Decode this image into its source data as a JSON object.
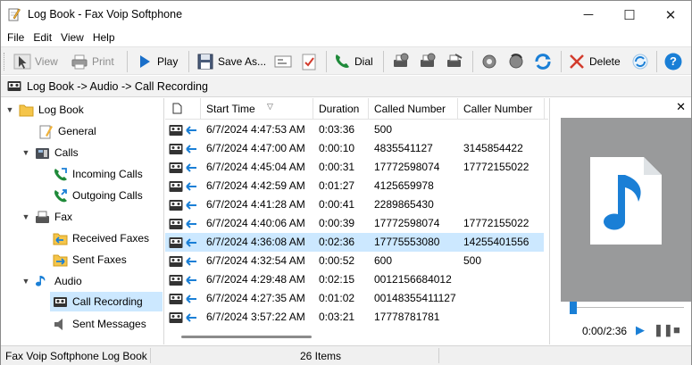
{
  "window": {
    "title": "Log Book - Fax Voip Softphone",
    "controls": {
      "minimize": "─",
      "maximize": "☐",
      "close": "✕"
    }
  },
  "menu": [
    {
      "label": "File"
    },
    {
      "label": "Edit"
    },
    {
      "label": "View"
    },
    {
      "label": "Help"
    }
  ],
  "toolbar": {
    "view_label": "View",
    "print_label": "Print",
    "play_label": "Play",
    "save_as_label": "Save As...",
    "dial_label": "Dial",
    "delete_label": "Delete",
    "help_label": "?"
  },
  "path": {
    "text": "Log Book -> Audio -> Call Recording"
  },
  "tree": {
    "log_book": "Log Book",
    "general": "General",
    "calls": "Calls",
    "incoming_calls": "Incoming Calls",
    "outgoing_calls": "Outgoing Calls",
    "fax": "Fax",
    "received_faxes": "Received Faxes",
    "sent_faxes": "Sent Faxes",
    "audio": "Audio",
    "call_recording": "Call Recording",
    "sent_messages": "Sent Messages"
  },
  "list": {
    "columns": {
      "start_time": "Start Time",
      "duration": "Duration",
      "called_number": "Called Number",
      "caller_number": "Caller Number"
    },
    "rows": [
      {
        "start": "6/7/2024 4:47:53 AM",
        "duration": "0:03:36",
        "called": "500",
        "caller": ""
      },
      {
        "start": "6/7/2024 4:47:00 AM",
        "duration": "0:00:10",
        "called": "4835541127",
        "caller": "3145854422"
      },
      {
        "start": "6/7/2024 4:45:04 AM",
        "duration": "0:00:31",
        "called": "17772598074",
        "caller": "17772155022"
      },
      {
        "start": "6/7/2024 4:42:59 AM",
        "duration": "0:01:27",
        "called": "4125659978",
        "caller": ""
      },
      {
        "start": "6/7/2024 4:41:28 AM",
        "duration": "0:00:41",
        "called": "2289865430",
        "caller": ""
      },
      {
        "start": "6/7/2024 4:40:06 AM",
        "duration": "0:00:39",
        "called": "17772598074",
        "caller": "17772155022"
      },
      {
        "start": "6/7/2024 4:36:08 AM",
        "duration": "0:02:36",
        "called": "17775553080",
        "caller": "14255401556"
      },
      {
        "start": "6/7/2024 4:32:54 AM",
        "duration": "0:00:52",
        "called": "600",
        "caller": "500"
      },
      {
        "start": "6/7/2024 4:29:48 AM",
        "duration": "0:02:15",
        "called": "0012156684012",
        "caller": ""
      },
      {
        "start": "6/7/2024 4:27:35 AM",
        "duration": "0:01:02",
        "called": "00148355411127",
        "caller": ""
      },
      {
        "start": "6/7/2024 3:57:22 AM",
        "duration": "0:03:21",
        "called": "17778781781",
        "caller": ""
      }
    ],
    "selected_index": 6
  },
  "player": {
    "time": "0:00/2:36",
    "close": "✕",
    "progress": 0.0
  },
  "status": {
    "left": "Fax Voip Softphone Log Book",
    "count": "26 Items"
  },
  "colors": {
    "selection": "#cce8ff",
    "accent_blue": "#1a7fd6",
    "preview_bg": "#999a9b"
  }
}
